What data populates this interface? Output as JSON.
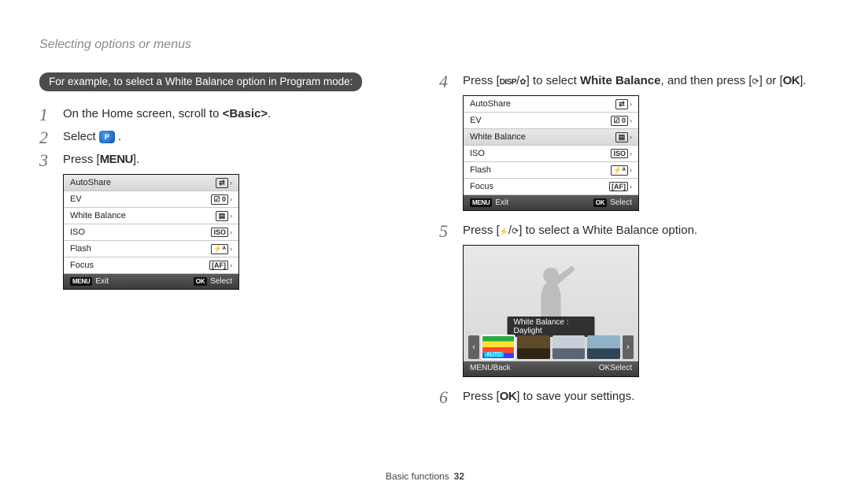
{
  "page_title": "Selecting options or menus",
  "pill": "For example, to select a White Balance option in Program mode:",
  "footer": {
    "section": "Basic functions",
    "page": "32"
  },
  "steps_left": [
    {
      "n": "1",
      "html": "On the Home screen, scroll to <b>&lt;Basic&gt;</b>."
    },
    {
      "n": "2",
      "html": "Select <span class='p-icon'>P</span> ."
    },
    {
      "n": "3",
      "html": "Press [<span class='key'>MENU</span>]."
    }
  ],
  "steps_right": [
    {
      "n": "4",
      "html": "Press [<span class='key ic-disp'></span>/<span class='ic-flower'></span>] to select <b>White Balance</b>, and then press [<span class='ic-timer'></span>] or [<span class='key'>OK</span>]."
    },
    {
      "n": "5",
      "html": "Press [<span class='ic-bolt'></span>/<span class='ic-timer'></span>] to select a White Balance option."
    },
    {
      "n": "6",
      "html": "Press [<span class='key'>OK</span>] to save your settings."
    }
  ],
  "menu": {
    "items": [
      {
        "label": "AutoShare",
        "value": "⇄"
      },
      {
        "label": "EV",
        "value": "☑ 0"
      },
      {
        "label": "White Balance",
        "value": "▤"
      },
      {
        "label": "ISO",
        "value": "ISO"
      },
      {
        "label": "Flash",
        "value": "⚡ᴬ"
      },
      {
        "label": "Focus",
        "value": "[AF]"
      }
    ],
    "footer_left_badge": "MENU",
    "footer_left": "Exit",
    "footer_right_badge": "OK",
    "footer_right": "Select",
    "selected_index_left": 0,
    "selected_index_right": 2
  },
  "wb_preview": {
    "label": "White Balance : Daylight",
    "auto_tag": "AUTO",
    "footer_left_badge": "MENU",
    "footer_left": "Back",
    "footer_right_badge": "OK",
    "footer_right": "Select"
  }
}
